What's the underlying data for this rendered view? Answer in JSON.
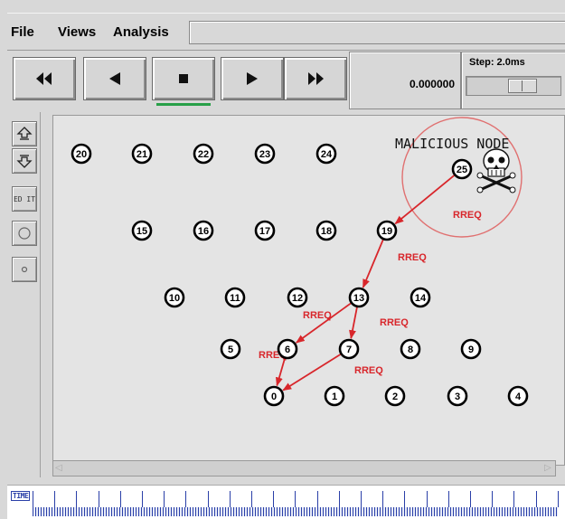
{
  "menu": {
    "file": "File",
    "views": "Views",
    "analysis": "Analysis"
  },
  "toolbar": {
    "rewind_icon": "fast-rewind-icon",
    "back_icon": "play-backward-icon",
    "stop_icon": "stop-icon",
    "play_icon": "play-forward-icon",
    "ff_icon": "fast-forward-icon",
    "time": "0.000000",
    "step_label": "Step: 2.0ms"
  },
  "leftstrip": {
    "edit_label": "ED IT"
  },
  "timeline": {
    "label": "TIME"
  },
  "network": {
    "title": "MALICIOUS NODE",
    "packet_label": "RREQ",
    "malicious_node": "25",
    "nodes": [
      "0",
      "1",
      "2",
      "3",
      "4",
      "5",
      "6",
      "7",
      "8",
      "9",
      "10",
      "11",
      "12",
      "13",
      "14",
      "15",
      "16",
      "17",
      "18",
      "19",
      "20",
      "21",
      "22",
      "23",
      "24",
      "25"
    ],
    "links": [
      {
        "from": "25",
        "to": "19",
        "label": "RREQ"
      },
      {
        "from": "19",
        "to": "13",
        "label": "RREQ"
      },
      {
        "from": "13",
        "to": "6",
        "label": "RREQ"
      },
      {
        "from": "13",
        "to": "7",
        "label": "RREQ"
      },
      {
        "from": "6",
        "to": "0",
        "label": "RREQ"
      },
      {
        "from": "7",
        "to": "0",
        "label": "RREQ"
      }
    ]
  },
  "colors": {
    "link": "#d8262b",
    "ring": "#e07070",
    "node_fill": "#ffffff",
    "node_stroke": "#000000"
  }
}
